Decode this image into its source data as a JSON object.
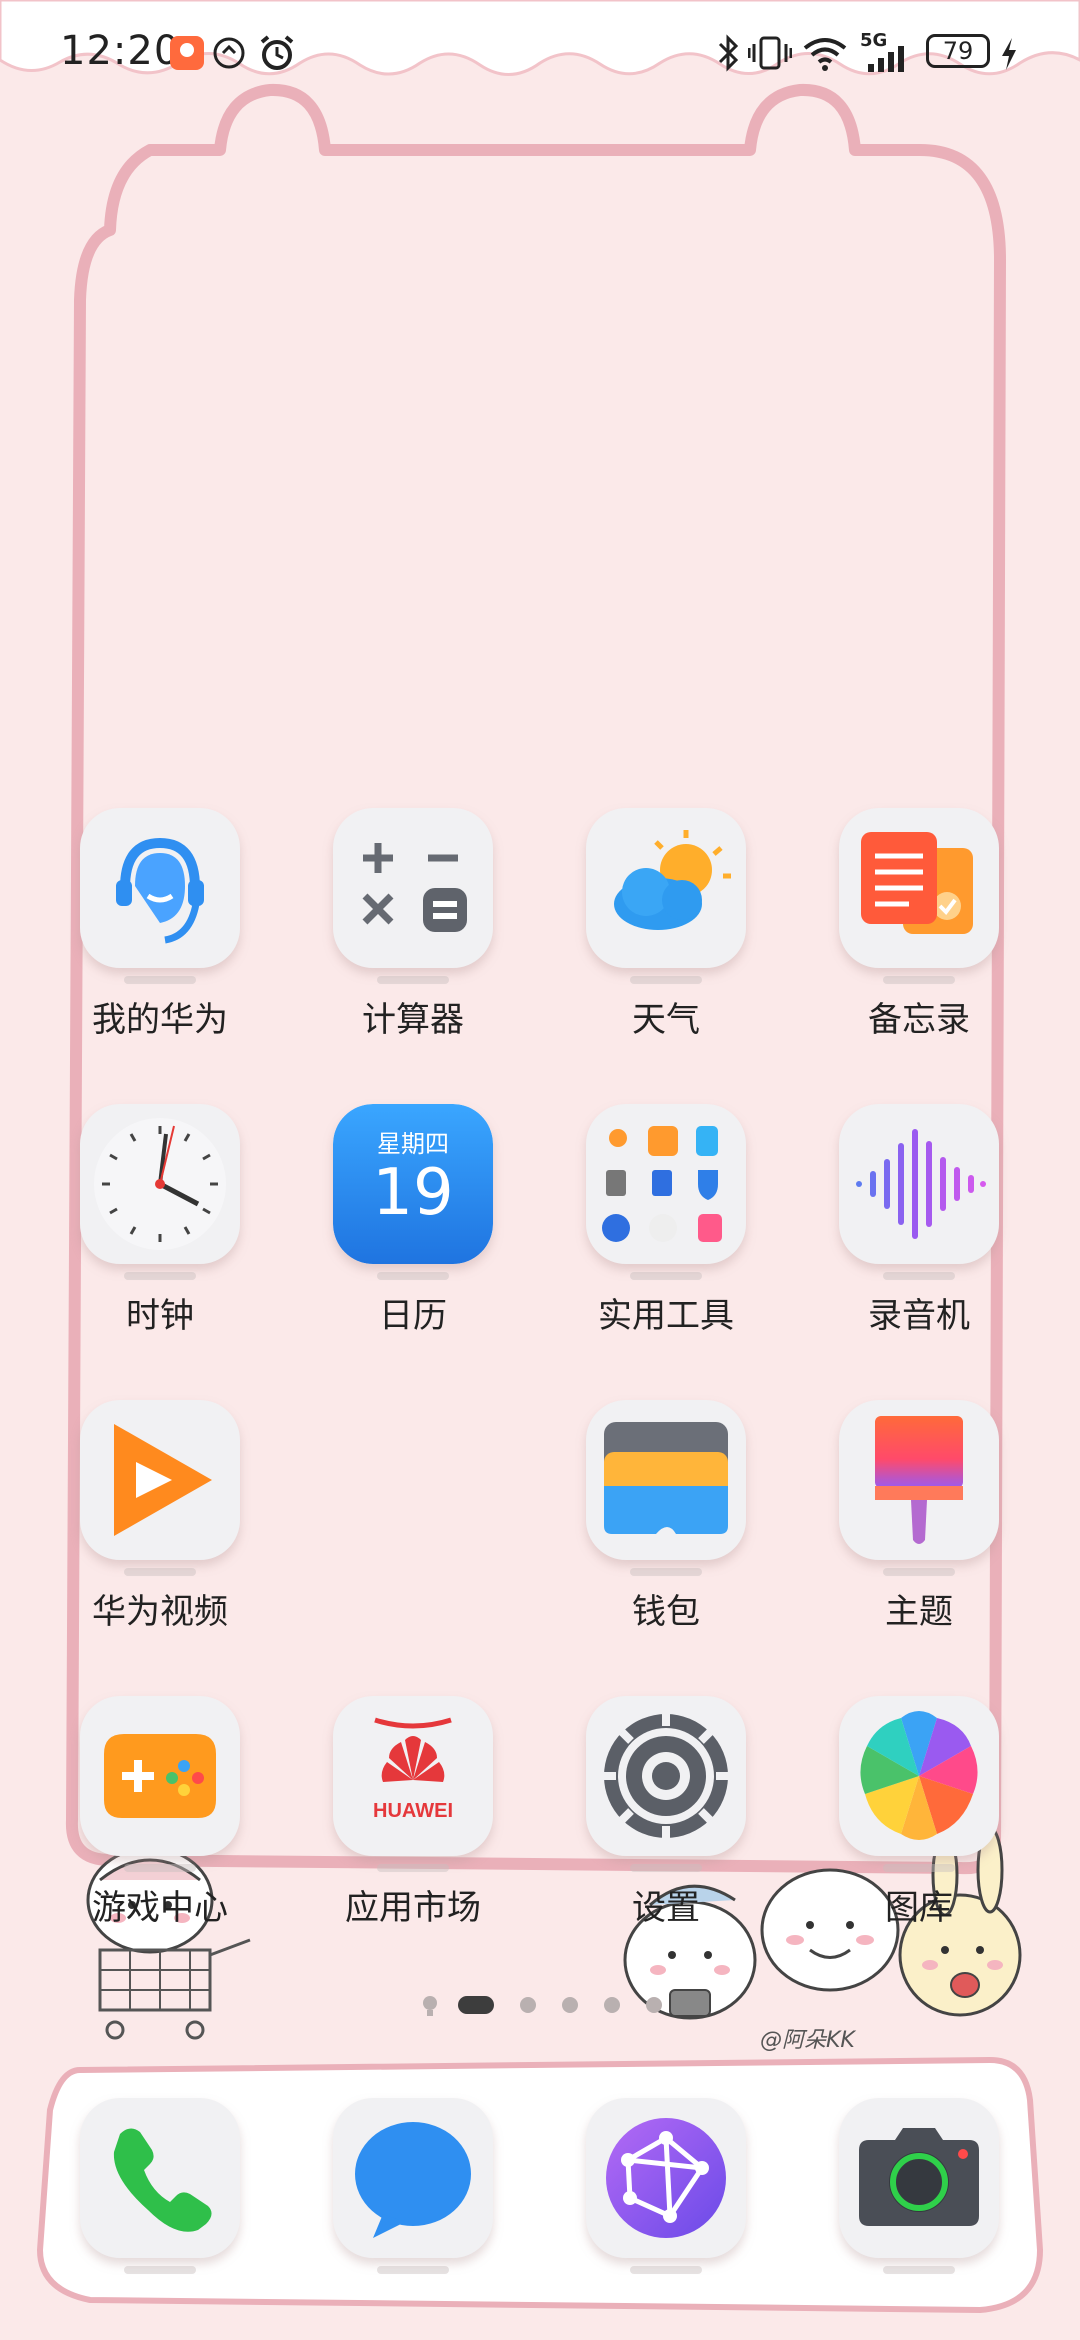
{
  "status_bar": {
    "time": "12:20",
    "battery": "79",
    "network": "5G"
  },
  "apps": [
    {
      "label": "我的华为",
      "icon": "huawei-support-icon"
    },
    {
      "label": "计算器",
      "icon": "calculator-icon"
    },
    {
      "label": "天气",
      "icon": "weather-icon"
    },
    {
      "label": "备忘录",
      "icon": "notepad-icon"
    },
    {
      "label": "时钟",
      "icon": "clock-icon"
    },
    {
      "label": "日历",
      "icon": "calendar-icon",
      "weekday": "星期四",
      "day": "19"
    },
    {
      "label": "实用工具",
      "icon": "tools-folder-icon"
    },
    {
      "label": "录音机",
      "icon": "recorder-icon"
    },
    {
      "label": "华为视频",
      "icon": "video-icon"
    },
    {
      "label": "钱包",
      "icon": "wallet-icon"
    },
    {
      "label": "主题",
      "icon": "themes-icon"
    },
    {
      "label": "游戏中心",
      "icon": "game-center-icon"
    },
    {
      "label": "应用市场",
      "icon": "app-gallery-icon",
      "brand": "HUAWEI"
    },
    {
      "label": "设置",
      "icon": "settings-icon"
    },
    {
      "label": "图库",
      "icon": "gallery-icon"
    }
  ],
  "dock": [
    {
      "icon": "phone-icon"
    },
    {
      "icon": "messages-icon"
    },
    {
      "icon": "browser-icon"
    },
    {
      "icon": "camera-icon"
    }
  ],
  "page_indicator": {
    "pages": 5,
    "current": 1
  },
  "wallpaper": {
    "signature": "@阿朵KK"
  },
  "colors": {
    "background": "#fbe9e9",
    "frame": "#e8a9b3"
  }
}
